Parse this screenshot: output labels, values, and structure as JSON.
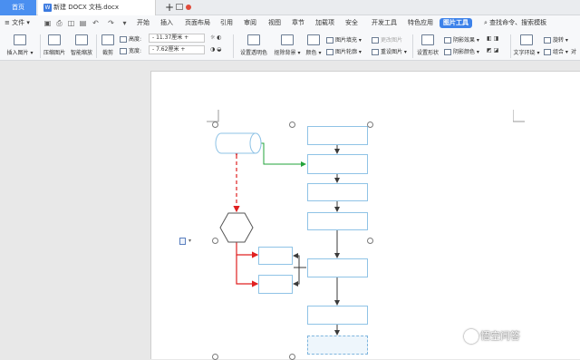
{
  "tabbar": {
    "home_label": "首页",
    "doc_badge": "W",
    "doc_title": "新建 DOCX 文档.docx",
    "add_tab": "+"
  },
  "menubar": {
    "file_label": "≡ 文件 ▾",
    "items": [
      "开始",
      "插入",
      "页面布局",
      "引用",
      "审阅",
      "视图",
      "章节",
      "加载项",
      "安全",
      "开发工具",
      "特色应用",
      "图片工具"
    ],
    "active_item": "图片工具",
    "search_label": "查找命令、搜索模板"
  },
  "ribbon": {
    "insert_picture": "插入图片 ▾",
    "compress": "压缩图片",
    "smart_zoom": "智能缩放",
    "crop": "裁剪",
    "height_label": "高度:",
    "height_value": "11.37厘米",
    "width_label": "宽度:",
    "width_value": "7.62厘米",
    "transparent": "设置透明色",
    "remove_bg": "抠除背景 ▾",
    "color": "颜色 ▾",
    "pic_fill": "图片填充 ▾",
    "pic_outline": "图片轮廓 ▾",
    "change_pic": "更改图片",
    "reset_pic": "重设图片 ▾",
    "set_shape": "设置形状",
    "shadow_effect": "阴影效果 ▾",
    "shadow_color": "阴影颜色 ▾",
    "text_wrap": "文字环绕 ▾",
    "rotate": "旋转 ▾",
    "group": "组合 ▾",
    "align": "对"
  },
  "watermark": "悟空问答",
  "colors": {
    "accent": "#3d82ea",
    "shape_border": "#8fc3e6",
    "green_arrow": "#22a33a",
    "red_arrow": "#e02020",
    "dark_arrow": "#3a3a3a"
  }
}
